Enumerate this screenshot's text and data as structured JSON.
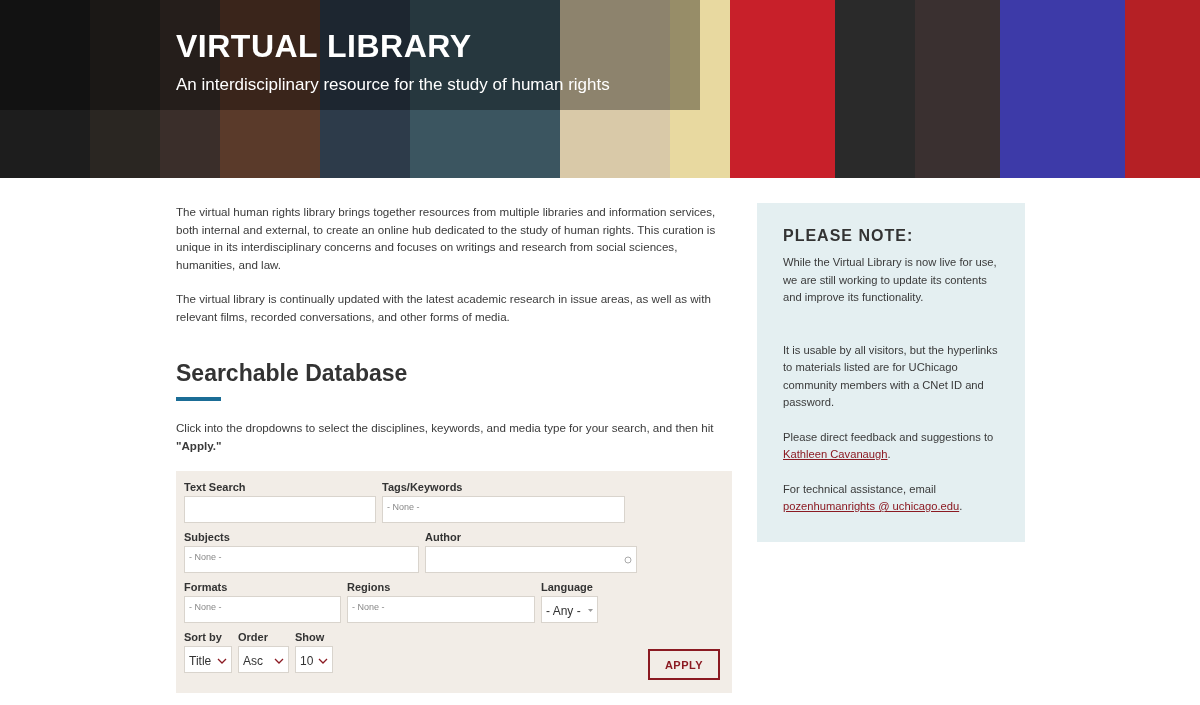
{
  "header": {
    "kind": "picture",
    "title": "VIRTUAL LIBRARY",
    "subtitle": "An interdisciplinary resource for the study of human rights"
  },
  "intro": [
    "The virtual human rights library brings together resources from multiple libraries and information services, both internal and external, to create an online hub dedicated to the study of human rights. This curation is unique in its interdisciplinary concerns and focuses on writings and research from social sciences, humanities, and law.",
    "The virtual library is continually updated with the latest academic research in issue areas, as well as with relevant films, recorded conversations, and other forms of media."
  ],
  "section": {
    "heading": "Searchable Database",
    "instructions": "Click into the dropdowns to select the disciplines, keywords, and media type for your search, and then hit **\"Apply.\"**"
  },
  "form": {
    "rows": [
      [
        {
          "label": "Text Search",
          "kind": "text"
        },
        {
          "label": "Tags/Keywords",
          "kind": "multiselect",
          "placeholder": "- None -"
        }
      ],
      [
        {
          "label": "Subjects",
          "kind": "multiselect",
          "placeholder": "- None -"
        },
        {
          "label": "Author",
          "kind": "autocomplete"
        }
      ],
      [
        {
          "label": "Formats",
          "kind": "multiselect",
          "placeholder": "- None -"
        },
        {
          "label": "Regions",
          "kind": "multiselect",
          "placeholder": "- None -"
        },
        {
          "label": "Language",
          "kind": "dropdown",
          "value": "- Any -"
        }
      ],
      [
        {
          "label": "Sort by",
          "kind": "select",
          "value": "Title"
        },
        {
          "label": "Order",
          "kind": "select",
          "value": "Asc"
        },
        {
          "label": "Show",
          "kind": "select",
          "value": "10"
        }
      ]
    ],
    "apply": "APPLY"
  },
  "note": {
    "heading": "PLEASE NOTE:",
    "paragraphs": [
      {
        "text": "While the Virtual Library is now live for use, we are still working to update its contents and improve its functionality."
      },
      {
        "text": "It is usable by all visitors, but the hyperlinks to materials listed are for UChicago community members with a CNet ID and password."
      },
      {
        "text": "Please direct feedback and suggestions to ",
        "link": "Kathleen Cavanaugh",
        "after": "."
      },
      {
        "text": "For technical assistance, email ",
        "link": "pozenhumanrights @ uchicago.edu",
        "after": "."
      }
    ]
  }
}
